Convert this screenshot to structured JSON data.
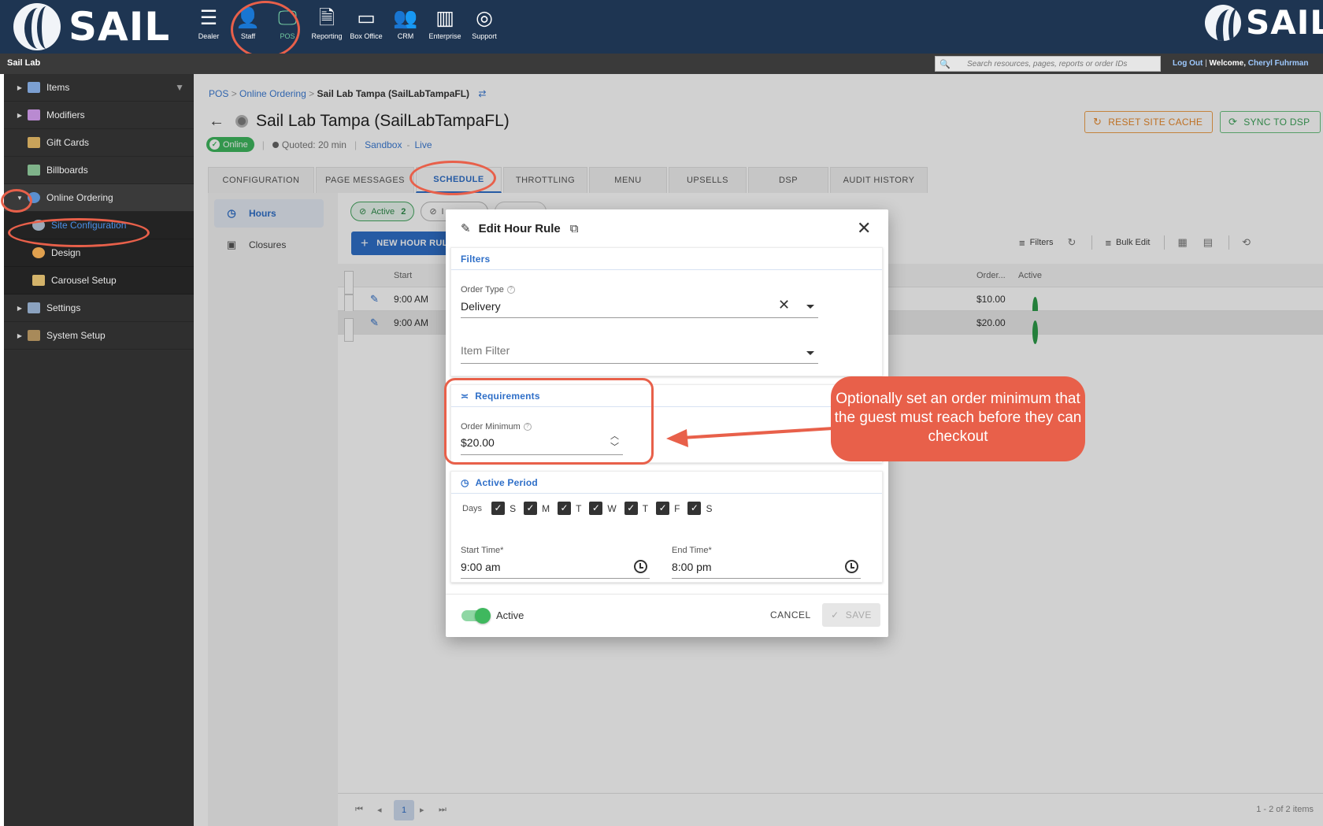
{
  "topbar": {
    "logo_text": "SAIL",
    "nav": [
      {
        "label": "Dealer",
        "icon": "server-stack-icon"
      },
      {
        "label": "Staff",
        "icon": "person-icon"
      },
      {
        "label": "POS",
        "icon": "monitor-icon"
      },
      {
        "label": "Reporting",
        "icon": "document-icon"
      },
      {
        "label": "Box Office",
        "icon": "ticket-printer-icon"
      },
      {
        "label": "CRM",
        "icon": "people-icon"
      },
      {
        "label": "Enterprise",
        "icon": "building-icon"
      },
      {
        "label": "Support",
        "icon": "lifebuoy-icon"
      }
    ],
    "active_nav": "POS",
    "active_color": "#72c8a0"
  },
  "secbar": {
    "org": "Sail Lab",
    "search_placeholder": "Search resources, pages, reports or order IDs",
    "logout": "Log Out",
    "separator": "|",
    "welcome": "Welcome,",
    "user": "Cheryl Fuhrman"
  },
  "sidebar": {
    "items": [
      {
        "label": "Items",
        "has_arrow": true
      },
      {
        "label": "Modifiers",
        "has_arrow": true
      },
      {
        "label": "Gift Cards",
        "has_arrow": false
      },
      {
        "label": "Billboards",
        "has_arrow": false
      },
      {
        "label": "Online Ordering",
        "has_arrow": true,
        "expanded": true
      },
      {
        "label": "Site Configuration",
        "sub": true,
        "selected": true
      },
      {
        "label": "Design",
        "sub": true
      },
      {
        "label": "Carousel Setup",
        "sub": true
      },
      {
        "label": "Settings",
        "has_arrow": true
      },
      {
        "label": "System Setup",
        "has_arrow": true
      }
    ]
  },
  "breadcrumb": {
    "items": [
      "POS",
      "Online Ordering"
    ],
    "separator": ">",
    "current": "Sail Lab Tampa (SailLabTampaFL)"
  },
  "page": {
    "title": "Sail Lab Tampa (SailLabTampaFL)",
    "status": "Online",
    "quoted": "Quoted: 20 min",
    "env_sandbox": "Sandbox",
    "env_separator": "-",
    "env_live": "Live",
    "reset_button": "RESET SITE CACHE",
    "sync_button": "SYNC TO DSP"
  },
  "tabs": [
    {
      "label": "CONFIGURATION",
      "w": 135
    },
    {
      "label": "PAGE MESSAGES",
      "w": 125
    },
    {
      "label": "SCHEDULE",
      "w": 109,
      "active": true
    },
    {
      "label": "THROTTLING",
      "w": 107
    },
    {
      "label": "MENU",
      "w": 99
    },
    {
      "label": "UPSELLS",
      "w": 99
    },
    {
      "label": "DSP",
      "w": 102
    },
    {
      "label": "AUDIT HISTORY",
      "w": 124
    }
  ],
  "subnav": [
    {
      "label": "Hours",
      "active": true
    },
    {
      "label": "Closures"
    }
  ],
  "grid": {
    "chip_active": "Active",
    "chip_active_count": "2",
    "chip_inactive": "I",
    "new_rule": "NEW HOUR RULE",
    "toolbar": {
      "filters": "Filters",
      "bulk_edit": "Bulk Edit"
    },
    "columns": {
      "start": "Start",
      "order_min": "Order...",
      "active": "Active"
    },
    "rows": [
      {
        "start": "9:00 AM",
        "order_min": "$10.00"
      },
      {
        "start": "9:00 AM",
        "order_min": "$20.00"
      }
    ],
    "pager": {
      "page": "1",
      "count": "1 - 2 of 2 items"
    }
  },
  "modal": {
    "title": "Edit Hour Rule",
    "filters_title": "Filters",
    "order_type_label": "Order Type",
    "order_type_value": "Delivery",
    "item_filter_placeholder": "Item Filter",
    "requirements_title": "Requirements",
    "order_min_label": "Order Minimum",
    "order_min_value": "$20.00",
    "active_period_title": "Active Period",
    "days_label": "Days",
    "days": [
      "S",
      "M",
      "T",
      "W",
      "T",
      "F",
      "S"
    ],
    "start_label": "Start Time*",
    "start_value": "9:00 am",
    "end_label": "End Time*",
    "end_value": "8:00 pm",
    "active_label": "Active",
    "cancel": "CANCEL",
    "save": "SAVE"
  },
  "callout": {
    "text": "Optionally set an order minimum that the guest must reach before they can checkout",
    "color": "#e8604a"
  },
  "colors": {
    "primary": "#2f6fc8",
    "success": "#3fb85e",
    "warning": "#e8892b",
    "annotation": "#e8604a"
  }
}
